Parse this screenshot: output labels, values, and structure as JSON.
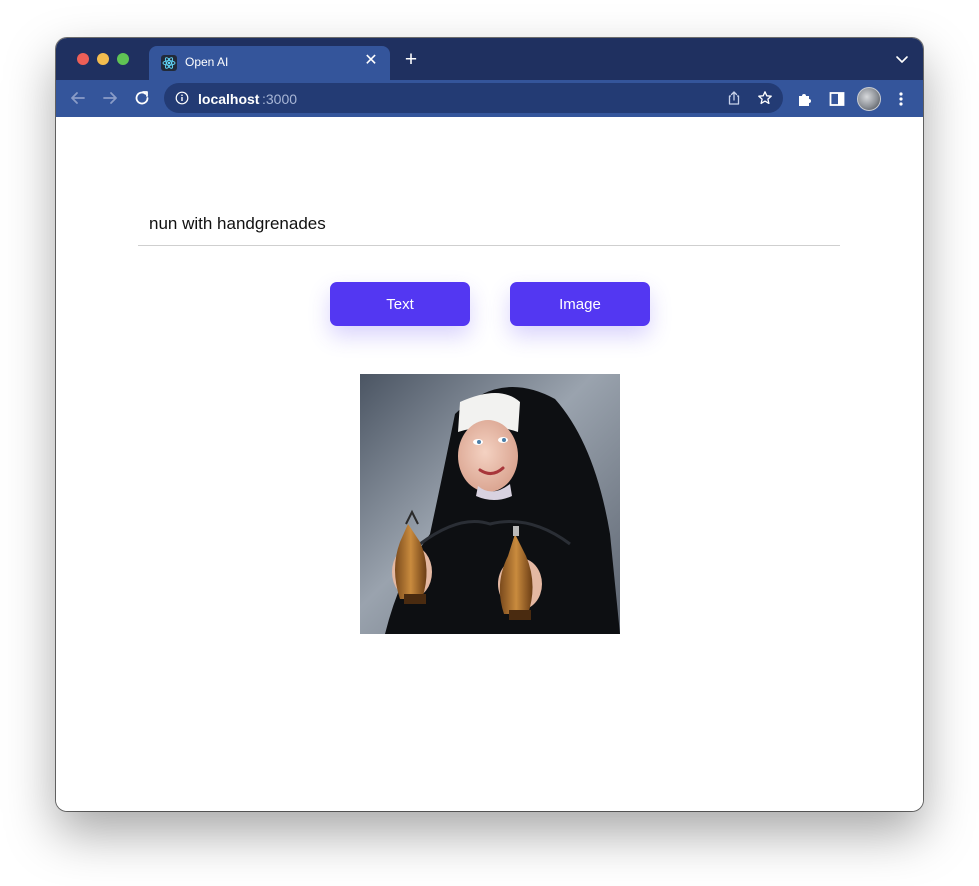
{
  "browser": {
    "tab": {
      "title": "Open AI",
      "favicon": "react-logo-icon",
      "close_icon": "close-icon"
    },
    "new_tab_icon": "plus-icon",
    "tab_menu_icon": "chevron-down-icon",
    "toolbar": {
      "back_icon": "arrow-left-icon",
      "forward_icon": "arrow-right-icon",
      "reload_icon": "reload-icon",
      "url_host": "localhost",
      "url_port": ":3000",
      "info_icon": "info-icon",
      "share_icon": "share-icon",
      "bookmark_icon": "star-icon",
      "extensions_icon": "puzzle-icon",
      "side_panel_icon": "side-panel-icon",
      "profile_icon": "avatar",
      "menu_icon": "more-vertical-icon"
    }
  },
  "page": {
    "prompt": {
      "value": "nun with handgrenades",
      "placeholder": ""
    },
    "buttons": {
      "text_label": "Text",
      "image_label": "Image"
    },
    "result_image": {
      "alt": "nun with handgrenades"
    }
  },
  "colors": {
    "accent": "#5337f2",
    "tab_strip": "#1f3060",
    "toolbar": "#34559b"
  }
}
